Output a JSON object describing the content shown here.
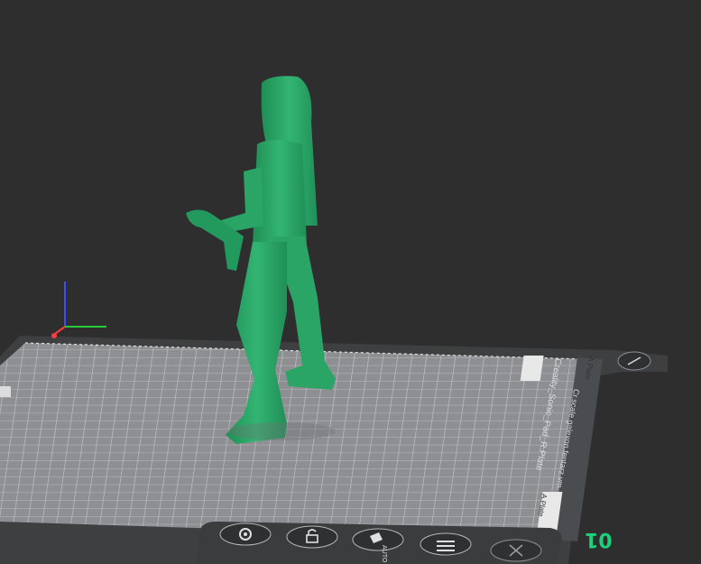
{
  "viewport": {
    "plate_name_label": "Creality_Sonic_Pad_R.Plate",
    "model_name_label": "Plate",
    "plate_tab_top": "A.Plate",
    "plate_tab_bottom": "A.Plate",
    "plate_file_label": "Cr.scale.galexon.fentarz.vm.",
    "plate_number": "01"
  },
  "toolbar": {
    "buttons": [
      {
        "name": "settings-icon"
      },
      {
        "name": "lock-icon"
      },
      {
        "name": "auto-orient-icon",
        "label": "AUTO"
      },
      {
        "name": "arrange-icon"
      },
      {
        "name": "close-icon"
      }
    ]
  },
  "colors": {
    "background": "#2e2e2f",
    "bed": "#8b8c90",
    "model": "#2aa566",
    "accent": "#19d27a"
  }
}
